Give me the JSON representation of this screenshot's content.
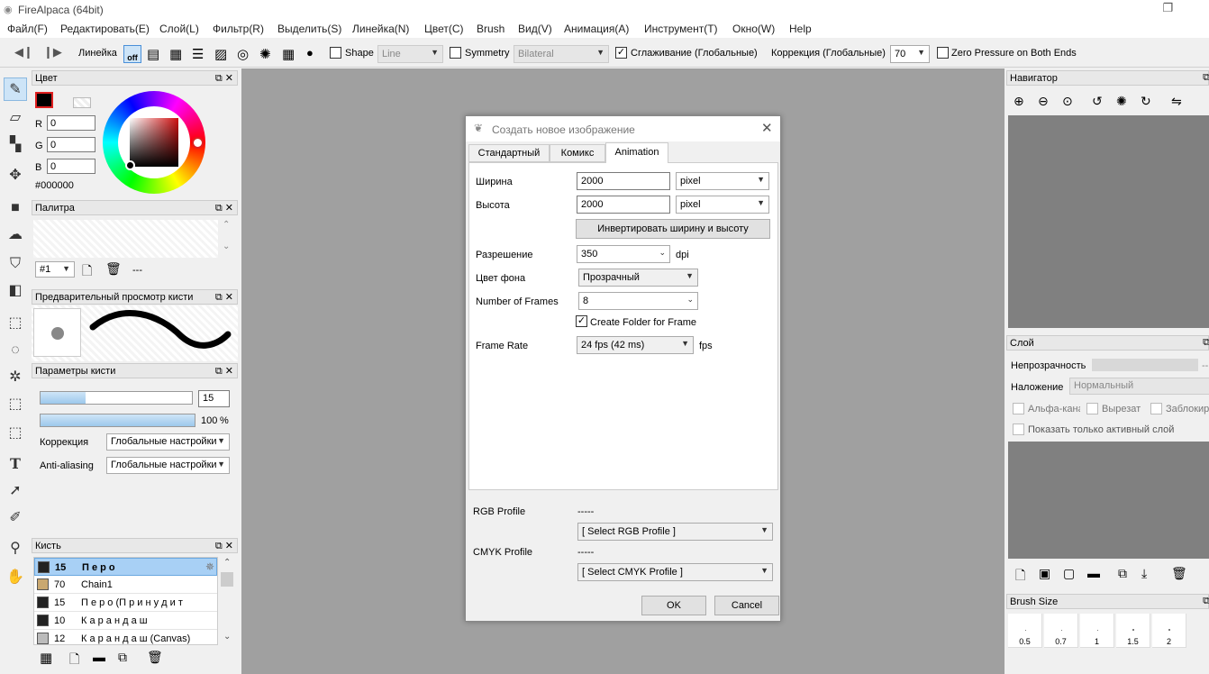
{
  "window": {
    "title": "FireAlpaca (64bit)"
  },
  "menu": [
    "Файл(F)",
    "Редактировать(E)",
    "Слой(L)",
    "Фильтр(R)",
    "Выделить(S)",
    "Линейка(N)",
    "Цвет(C)",
    "Brush",
    "Вид(V)",
    "Анимация(A)",
    "Инструмент(T)",
    "Окно(W)",
    "Help"
  ],
  "toolbar": {
    "ruler_label": "Линейка",
    "ruler_off": "off",
    "shape_label": "Shape",
    "shape_value": "Line",
    "symmetry_label": "Symmetry",
    "symmetry_value": "Bilateral",
    "smoothing_label": "Сглаживание (Глобальные)",
    "correction_label": "Коррекция (Глобальные)",
    "correction_value": "70",
    "zero_pressure_label": "Zero Pressure on Both Ends"
  },
  "color_panel": {
    "title": "Цвет",
    "r_label": "R",
    "r_value": "0",
    "g_label": "G",
    "g_value": "0",
    "b_label": "B",
    "b_value": "0",
    "hex": "#000000",
    "current_color": "#000000",
    "accent": "#e02020"
  },
  "palette_panel": {
    "title": "Палитра",
    "palette_no": "#1",
    "name": "---"
  },
  "brush_preview_panel": {
    "title": "Предварительный просмотр кисти"
  },
  "brush_params_panel": {
    "title": "Параметры кисти",
    "size_value": "15",
    "opacity_value": "100",
    "opacity_unit": "%",
    "size_fill": 0.3,
    "opacity_fill": 1.0,
    "correction_label": "Коррекция",
    "correction_value": "Глобальные настройки",
    "antialias_label": "Anti-aliasing",
    "antialias_value": "Глобальные настройки"
  },
  "brush_panel": {
    "title": "Кисть",
    "items": [
      {
        "size": "15",
        "name": "П е р о",
        "color": "#222222",
        "selected": true
      },
      {
        "size": "70",
        "name": "Chain1",
        "color": "#c9a870",
        "selected": false
      },
      {
        "size": "15",
        "name": "П е р о (П р и н у д и т",
        "color": "#222222",
        "selected": false
      },
      {
        "size": "10",
        "name": "К а р а н д а ш",
        "color": "#222222",
        "selected": false
      },
      {
        "size": "12",
        "name": "К а р а н д а ш (Canvas)",
        "color": "#bbbbbb",
        "selected": false
      }
    ]
  },
  "navigator_panel": {
    "title": "Навигатор"
  },
  "layer_panel": {
    "title": "Слой",
    "opacity_label": "Непрозрачность",
    "opacity_value": "--",
    "blend_label": "Наложение",
    "blend_value": "Нормальный",
    "alpha_label": "Альфа-кана",
    "clip_label": "Вырезат",
    "lock_label": "Заблокиро",
    "show_active_label": "Показать только активный слой"
  },
  "brush_size_panel": {
    "title": "Brush Size",
    "sizes": [
      "0.5",
      "0.7",
      "1",
      "1.5",
      "2"
    ]
  },
  "dialog": {
    "title": "Создать новое изображение",
    "tabs": [
      "Стандартный",
      "Комикс",
      "Animation"
    ],
    "active_tab": 2,
    "width_label": "Ширина",
    "width_value": "2000",
    "width_unit": "pixel",
    "height_label": "Высота",
    "height_value": "2000",
    "height_unit": "pixel",
    "swap_button": "Инвертировать ширину и высоту",
    "resolution_label": "Разрешение",
    "resolution_value": "350",
    "resolution_unit": "dpi",
    "bg_label": "Цвет фона",
    "bg_value": "Прозрачный",
    "frames_label": "Number of Frames",
    "frames_value": "8",
    "create_folder_label": "Create Folder  for Frame",
    "framerate_label": "Frame Rate",
    "framerate_value": "24 fps (42 ms)",
    "framerate_unit": "fps",
    "rgb_label": "RGB Profile",
    "rgb_dash": "-----",
    "rgb_select": "[ Select RGB Profile ]",
    "cmyk_label": "CMYK Profile",
    "cmyk_dash": "-----",
    "cmyk_select": "[ Select CMYK Profile ]",
    "ok": "OK",
    "cancel": "Cancel"
  }
}
